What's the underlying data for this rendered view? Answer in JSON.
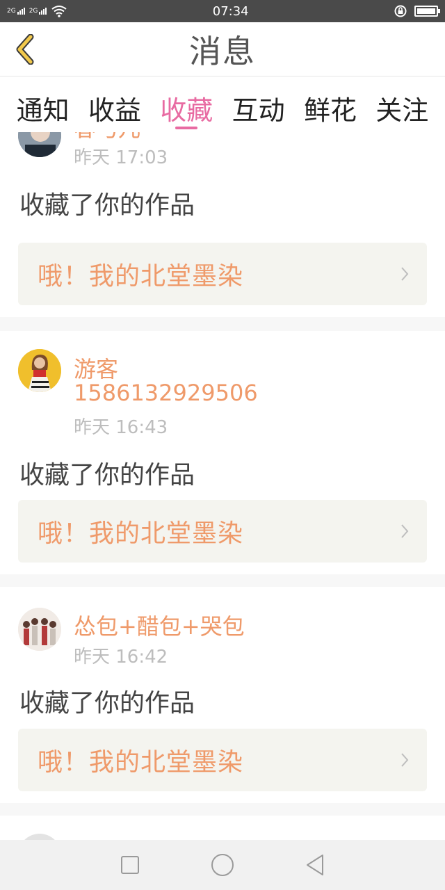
{
  "status": {
    "time": "07:34",
    "sim1": "2G",
    "sim2": "2G",
    "icons": [
      "signal-icon",
      "wifi-icon",
      "alarm-icon",
      "battery-icon"
    ]
  },
  "header": {
    "back_icon": "chevron-left-icon",
    "title": "消息"
  },
  "tabs": [
    {
      "label": "通知",
      "active": false
    },
    {
      "label": "收益",
      "active": false
    },
    {
      "label": "收藏",
      "active": true
    },
    {
      "label": "互动",
      "active": false
    },
    {
      "label": "鲜花",
      "active": false
    },
    {
      "label": "关注",
      "active": false
    }
  ],
  "colors": {
    "accent": "#e86ba2",
    "username": "#ef9a6a",
    "muted": "#bdbdbd",
    "box_bg": "#f4f4ef"
  },
  "messages": [
    {
      "username": "春弓儿",
      "time": "昨天 17:03",
      "action": "收藏了你的作品",
      "work_title": "哦！我的北堂墨染"
    },
    {
      "username": "游客",
      "username_line2": "1586132929506",
      "time": "昨天 16:43",
      "action": "收藏了你的作品",
      "work_title": "哦！我的北堂墨染"
    },
    {
      "username": "怂包+醋包+哭包",
      "time": "昨天 16:42",
      "action": "收藏了你的作品",
      "work_title": "哦！我的北堂墨染"
    }
  ],
  "navbar": {
    "icons": [
      "recents-square-icon",
      "home-circle-icon",
      "back-triangle-icon"
    ]
  }
}
